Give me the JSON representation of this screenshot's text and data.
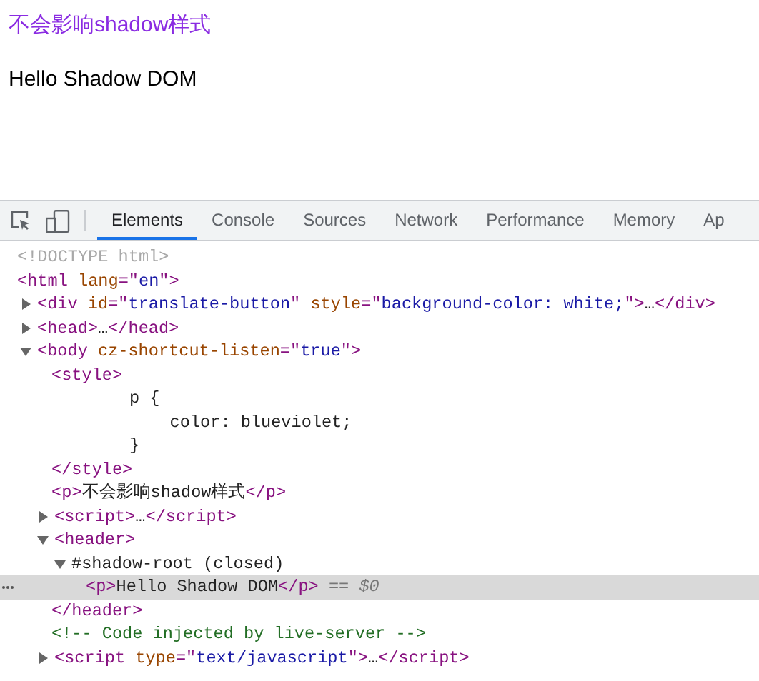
{
  "page": {
    "paragraphs": [
      {
        "kind": "styled",
        "text": "不会影响shadow样式"
      },
      {
        "kind": "plain",
        "text": "Hello Shadow DOM"
      }
    ]
  },
  "devtools": {
    "tabs": [
      {
        "label": "Elements",
        "selected": true
      },
      {
        "label": "Console",
        "selected": false
      },
      {
        "label": "Sources",
        "selected": false
      },
      {
        "label": "Network",
        "selected": false
      },
      {
        "label": "Performance",
        "selected": false
      },
      {
        "label": "Memory",
        "selected": false
      },
      {
        "label": "Ap",
        "selected": false
      }
    ],
    "tree": [
      {
        "selected": false,
        "tokens": [
          {
            "kind": "doctype",
            "text": "<!DOCTYPE html>"
          }
        ]
      },
      {
        "selected": false,
        "tokens": [
          {
            "kind": "tag",
            "text": "<html "
          },
          {
            "kind": "attr",
            "text": "lang"
          },
          {
            "kind": "tag",
            "text": "=\""
          },
          {
            "kind": "value",
            "text": "en"
          },
          {
            "kind": "tag",
            "text": "\">"
          }
        ],
        "children": [
          {
            "selected": false,
            "expanded": false,
            "tokens": [
              {
                "kind": "tag",
                "text": "<div "
              },
              {
                "kind": "attr",
                "text": "id"
              },
              {
                "kind": "tag",
                "text": "=\""
              },
              {
                "kind": "value",
                "text": "translate-button"
              },
              {
                "kind": "tag",
                "text": "\" "
              },
              {
                "kind": "attr",
                "text": "style"
              },
              {
                "kind": "tag",
                "text": "=\""
              },
              {
                "kind": "value",
                "text": "background-color: white;"
              },
              {
                "kind": "tag",
                "text": "\">"
              },
              {
                "kind": "text",
                "text": "…"
              },
              {
                "kind": "tag",
                "text": "</div>"
              }
            ]
          },
          {
            "selected": false,
            "expanded": false,
            "tokens": [
              {
                "kind": "tag",
                "text": "<head>"
              },
              {
                "kind": "text",
                "text": "…"
              },
              {
                "kind": "tag",
                "text": "</head>"
              }
            ]
          },
          {
            "selected": false,
            "expanded": true,
            "tokens": [
              {
                "kind": "tag",
                "text": "<body "
              },
              {
                "kind": "attr",
                "text": "cz-shortcut-listen"
              },
              {
                "kind": "tag",
                "text": "=\""
              },
              {
                "kind": "value",
                "text": "true"
              },
              {
                "kind": "tag",
                "text": "\">"
              }
            ],
            "children": [
              {
                "selected": false,
                "tokens": [
                  {
                    "kind": "tag",
                    "text": "<style>"
                  }
                ],
                "close": [
                  {
                    "kind": "tag",
                    "text": "</style>"
                  }
                ],
                "children": [
                  {
                    "selected": false,
                    "tokens": [
                      {
                        "kind": "text",
                        "text": "      p {"
                      }
                    ]
                  },
                  {
                    "selected": false,
                    "tokens": [
                      {
                        "kind": "text",
                        "text": "          color: blueviolet;"
                      }
                    ]
                  },
                  {
                    "selected": false,
                    "tokens": [
                      {
                        "kind": "text",
                        "text": "      }"
                      }
                    ]
                  }
                ]
              },
              {
                "selected": false,
                "tokens": [
                  {
                    "kind": "tag",
                    "text": "<p>"
                  },
                  {
                    "kind": "text",
                    "text": "不会影响shadow样式"
                  },
                  {
                    "kind": "tag",
                    "text": "</p>"
                  }
                ]
              },
              {
                "selected": false,
                "expanded": false,
                "tokens": [
                  {
                    "kind": "tag",
                    "text": "<script>"
                  },
                  {
                    "kind": "text",
                    "text": "…"
                  },
                  {
                    "kind": "tag",
                    "text": "</script>"
                  }
                ]
              },
              {
                "selected": false,
                "expanded": true,
                "tokens": [
                  {
                    "kind": "tag",
                    "text": "<header>"
                  }
                ],
                "close": [
                  {
                    "kind": "tag",
                    "text": "</header>"
                  }
                ],
                "children": [
                  {
                    "selected": false,
                    "expanded": true,
                    "tokens": [
                      {
                        "kind": "text",
                        "text": "#shadow-root (closed)"
                      }
                    ],
                    "children": [
                      {
                        "selected": true,
                        "tokens": [
                          {
                            "kind": "tag",
                            "text": "<p>"
                          },
                          {
                            "kind": "text",
                            "text": "Hello Shadow DOM"
                          },
                          {
                            "kind": "tag",
                            "text": "</p>"
                          },
                          {
                            "kind": "suffix",
                            "text": " == "
                          },
                          {
                            "kind": "var",
                            "text": "$0"
                          }
                        ]
                      }
                    ]
                  }
                ]
              },
              {
                "selected": false,
                "tokens": [
                  {
                    "kind": "comment",
                    "text": "<!-- Code injected by live-server -->"
                  }
                ]
              },
              {
                "selected": false,
                "expanded": false,
                "tokens": [
                  {
                    "kind": "tag",
                    "text": "<script "
                  },
                  {
                    "kind": "attr",
                    "text": "type"
                  },
                  {
                    "kind": "tag",
                    "text": "=\""
                  },
                  {
                    "kind": "value",
                    "text": "text/javascript"
                  },
                  {
                    "kind": "tag",
                    "text": "\">"
                  },
                  {
                    "kind": "text",
                    "text": "…"
                  },
                  {
                    "kind": "tag",
                    "text": "</script>"
                  }
                ]
              }
            ]
          }
        ]
      }
    ]
  }
}
